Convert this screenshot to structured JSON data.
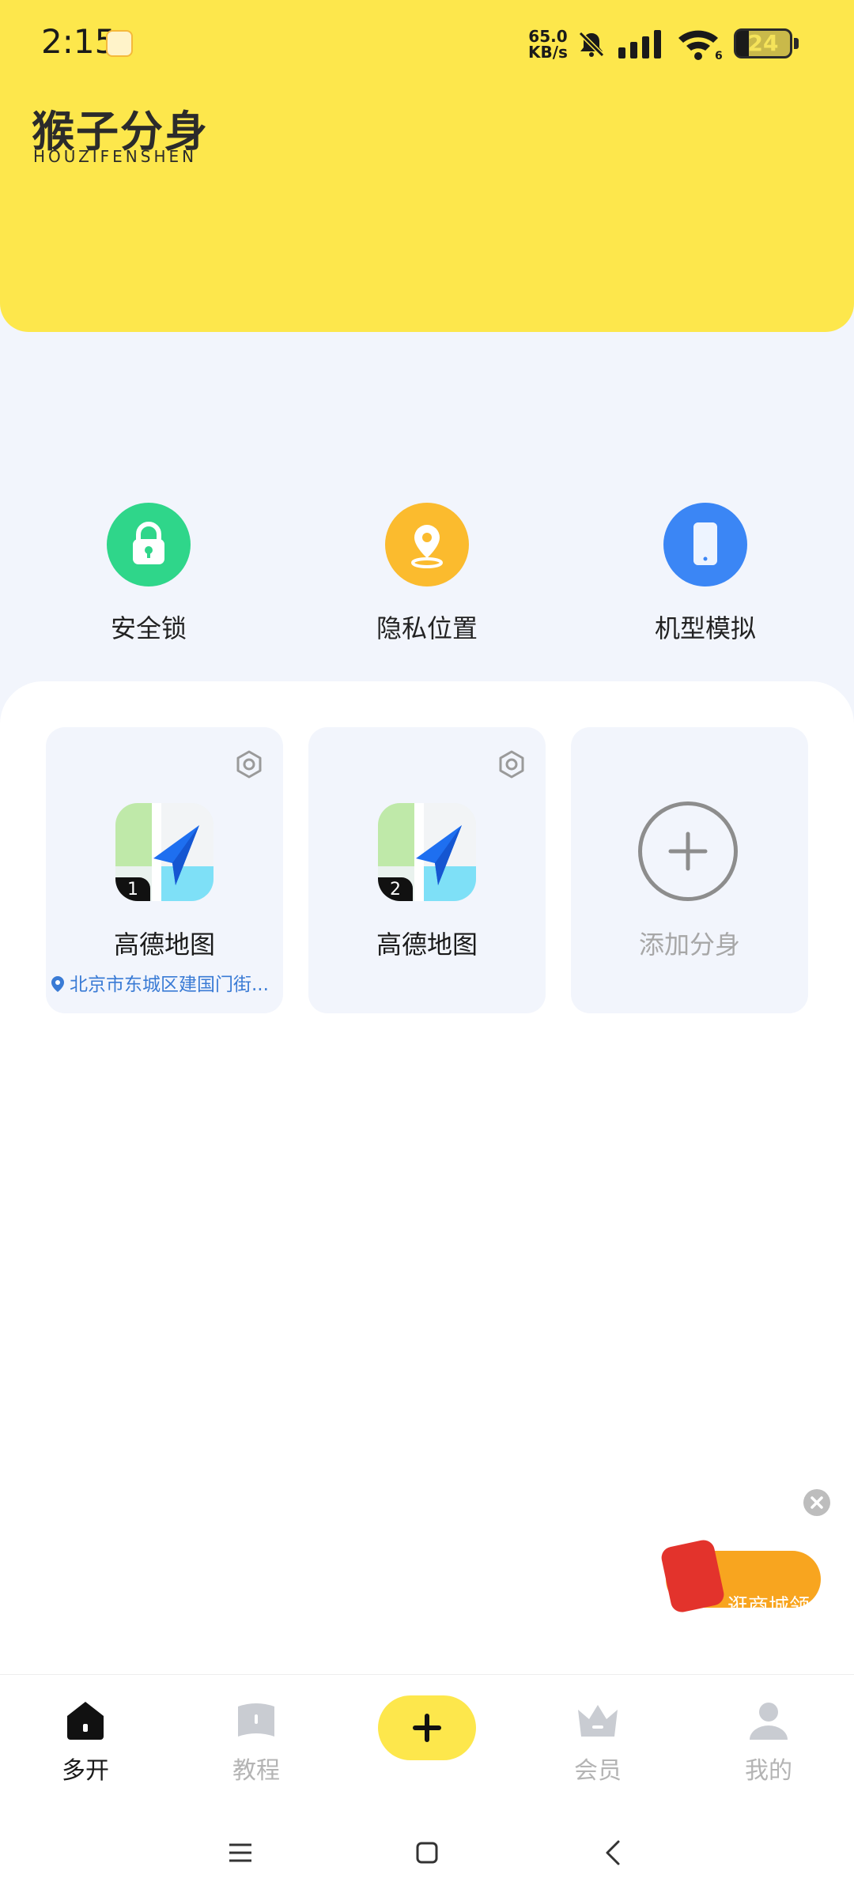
{
  "status_bar": {
    "time": "2:15",
    "net_speed_value": "65.0",
    "net_speed_unit": "KB/s",
    "wifi_label": "6",
    "battery": "24"
  },
  "header": {
    "logo_cn": "猴子分身",
    "logo_en": "HOUZIFENSHEN",
    "background_color": "#fde74c"
  },
  "features": [
    {
      "label": "安全锁",
      "icon": "lock-icon",
      "color": "#2fd68a"
    },
    {
      "label": "隐私位置",
      "icon": "location-pin-icon",
      "color": "#fbbb2e"
    },
    {
      "label": "机型模拟",
      "icon": "phone-icon",
      "color": "#3b86f5"
    }
  ],
  "clones": [
    {
      "name": "高德地图",
      "badge": "1",
      "location": "北京市东城区建国门街..."
    },
    {
      "name": "高德地图",
      "badge": "2",
      "location": ""
    }
  ],
  "add_clone_label": "添加分身",
  "promo": {
    "text": "逛商城领"
  },
  "bottom_nav": {
    "items": [
      {
        "label": "多开",
        "icon": "home-icon",
        "active": true
      },
      {
        "label": "教程",
        "icon": "book-icon",
        "active": false
      },
      {
        "label": "会员",
        "icon": "crown-icon",
        "active": false
      },
      {
        "label": "我的",
        "icon": "user-icon",
        "active": false
      }
    ],
    "center_button_icon": "plus-icon"
  },
  "system_nav": [
    "menu-icon",
    "home-square-icon",
    "back-icon"
  ]
}
